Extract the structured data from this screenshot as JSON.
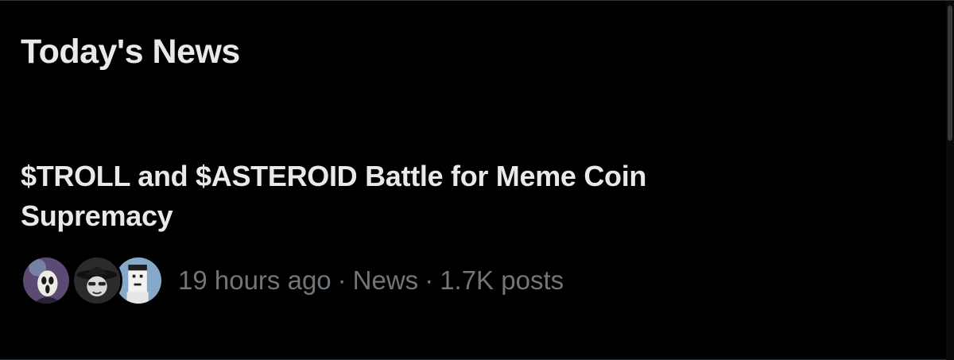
{
  "section": {
    "title": "Today's News"
  },
  "news_item": {
    "headline": "$TROLL and $ASTEROID Battle for Meme Coin Supremacy",
    "time_ago": "19 hours ago",
    "separator": "·",
    "category": "News",
    "post_count": "1.7K posts"
  },
  "avatars": [
    {
      "icon": "ghostface-avatar-icon"
    },
    {
      "icon": "hat-character-avatar-icon"
    },
    {
      "icon": "pixel-character-avatar-icon"
    }
  ],
  "colors": {
    "background": "#000000",
    "primary_text": "#e7e9ea",
    "secondary_text": "#71767b",
    "divider": "#2f3336"
  }
}
